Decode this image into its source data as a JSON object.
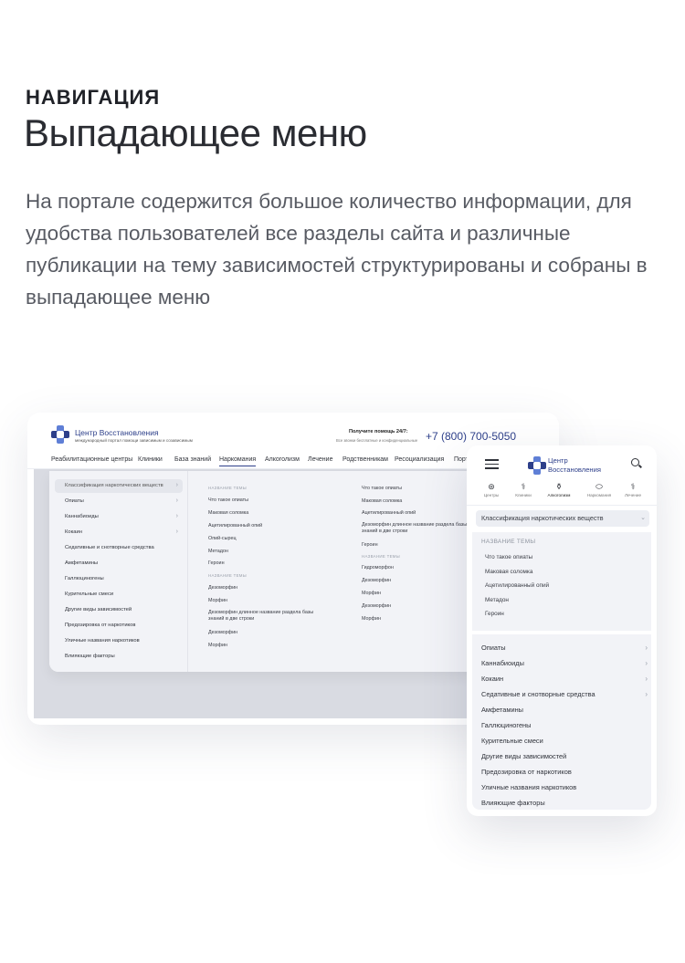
{
  "heading": {
    "kicker": "НАВИГАЦИЯ",
    "title": "Выпадающее меню",
    "description": "На портале содержится большое количество информации, для удобства пользователей все разделы сайта и различные публикации на тему зависимостей структурированы и собраны в выпадающее меню"
  },
  "brand": {
    "name": "Центр Восстановления",
    "name_line1": "Центр",
    "name_line2": "Восстановления",
    "tagline": "международный портал помощи зависимым и созависимым",
    "colors": {
      "primary": "#2d3f8a",
      "accent": "#5f7fd6"
    }
  },
  "contact": {
    "title": "Получите помощь 24/7:",
    "subtitle": "Все звонки бесплатные и конфиденциальные",
    "phone": "+7 (800) 700-5050"
  },
  "desktop_nav": {
    "items": [
      "Реабилитационные центры",
      "Клиники",
      "База знаний",
      "Наркомания",
      "Алкоголизм",
      "Лечение",
      "Родственникам",
      "Ресоциализация",
      "Порт"
    ],
    "active": "Наркомания"
  },
  "categories": {
    "selected": "Классификация наркотических веществ",
    "items": [
      {
        "label": "Классификация наркотических веществ",
        "has_submenu": true
      },
      {
        "label": "Опиаты",
        "has_submenu": true
      },
      {
        "label": "Каннабиоиды",
        "has_submenu": true
      },
      {
        "label": "Кокаин",
        "has_submenu": true
      },
      {
        "label": "Седативные и снотворные средства",
        "has_submenu": false
      },
      {
        "label": "Амфетамины",
        "has_submenu": false
      },
      {
        "label": "Галлюциногены",
        "has_submenu": false
      },
      {
        "label": "Курительные смеси",
        "has_submenu": false
      },
      {
        "label": "Другие виды зависимостей",
        "has_submenu": false
      },
      {
        "label": "Предозировка от наркотиков",
        "has_submenu": false
      },
      {
        "label": "Уличные названия наркотиков",
        "has_submenu": false
      },
      {
        "label": "Влияющие факторы",
        "has_submenu": false
      }
    ]
  },
  "desktop_columns": {
    "col1": [
      "НАЗВАНИЕ ТЕМЫ",
      "Что такое опиаты",
      "Маковая соломка",
      "Ацетилированный опий",
      "Опий-сырец",
      "Метадон",
      "Героин",
      "НАЗВАНИЕ ТЕМЫ",
      "Дезоморфин",
      "Морфин",
      "Дезоморфин длинное название раздела базы знаний в две строки",
      "Дезоморфин",
      "Морфин"
    ],
    "col2": [
      "Что такое опиаты",
      "Маковая соломка",
      "Ацетилированный опий",
      "Дезоморфин длинное название раздела базы знаний в две строки",
      "Героин",
      "НАЗВАНИЕ ТЕМЫ",
      "Гидроморфон",
      "Дезоморфин",
      "Морфин",
      "Дезоморфин",
      "Морфин"
    ]
  },
  "mobile": {
    "tabs": [
      {
        "label": "Центры",
        "icon": "lifebuoy-icon"
      },
      {
        "label": "Клиники",
        "icon": "stethoscope-icon"
      },
      {
        "label": "Алкоголизм",
        "icon": "bottle-icon"
      },
      {
        "label": "Наркомания",
        "icon": "pills-icon"
      },
      {
        "label": "Лечение",
        "icon": "doctor-icon"
      }
    ],
    "active_tab": "Алкоголизм",
    "select_value": "Классификация наркотических веществ",
    "topics_header": "НАЗВАНИЕ ТЕМЫ",
    "topics": [
      "Что такое опиаты",
      "Маковая соломка",
      "Ацетилированный опий",
      "Метадон",
      "Героин"
    ],
    "categories": [
      {
        "label": "Опиаты",
        "has_submenu": true
      },
      {
        "label": "Каннабиоиды",
        "has_submenu": true
      },
      {
        "label": "Кокаин",
        "has_submenu": true
      },
      {
        "label": "Седативные и снотворные средства",
        "has_submenu": true
      },
      {
        "label": "Амфетамины",
        "has_submenu": false
      },
      {
        "label": "Галлюциногены",
        "has_submenu": false
      },
      {
        "label": "Курительные смеси",
        "has_submenu": false
      },
      {
        "label": "Другие виды зависимостей",
        "has_submenu": false
      },
      {
        "label": "Предозировка от наркотиков",
        "has_submenu": false
      },
      {
        "label": "Уличные названия наркотиков",
        "has_submenu": false
      },
      {
        "label": "Влияющие факторы",
        "has_submenu": false
      }
    ]
  }
}
